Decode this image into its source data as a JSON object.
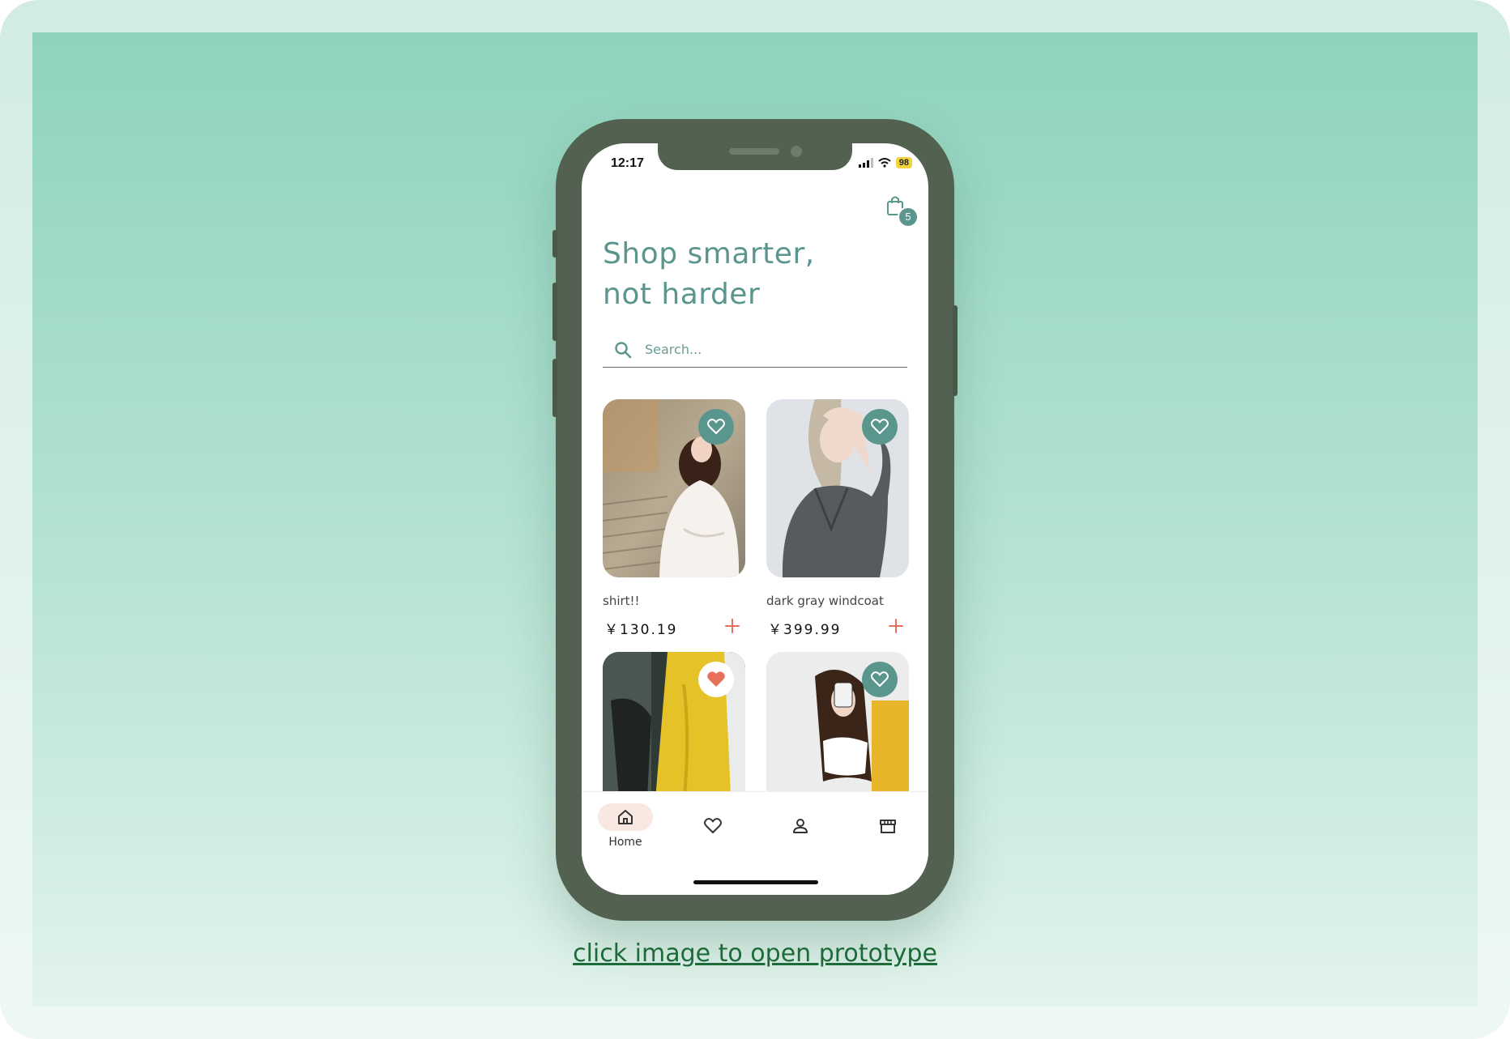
{
  "status_bar": {
    "time": "12:17",
    "battery": "98"
  },
  "header": {
    "cart_icon": "shopping-bag-icon",
    "cart_count": "5"
  },
  "hero": {
    "headline_line1": "Shop smarter,",
    "headline_line2": "not harder"
  },
  "search": {
    "placeholder": "Search...",
    "value": "",
    "icon": "search-icon"
  },
  "products": [
    {
      "name": "shirt!!",
      "price": "￥130.19",
      "favorited": false
    },
    {
      "name": "dark gray windcoat",
      "price": "￥399.99",
      "favorited": false
    },
    {
      "name": "",
      "price": "",
      "favorited": true
    },
    {
      "name": "",
      "price": "",
      "favorited": false
    }
  ],
  "tab_bar": {
    "tabs": [
      {
        "label": "Home",
        "icon": "home-icon",
        "active": true
      },
      {
        "label": "",
        "icon": "heart-icon",
        "active": false
      },
      {
        "label": "",
        "icon": "user-icon",
        "active": false
      },
      {
        "label": "",
        "icon": "store-icon",
        "active": false
      }
    ]
  },
  "footer": {
    "link_text": "click image to open prototype"
  },
  "colors": {
    "accent": "#5a968e",
    "favorite_active": "#e8705a",
    "add_button": "#e8705a",
    "phone_body": "#526150",
    "background_top": "#8fd3bd",
    "link": "#1e6b3a"
  }
}
